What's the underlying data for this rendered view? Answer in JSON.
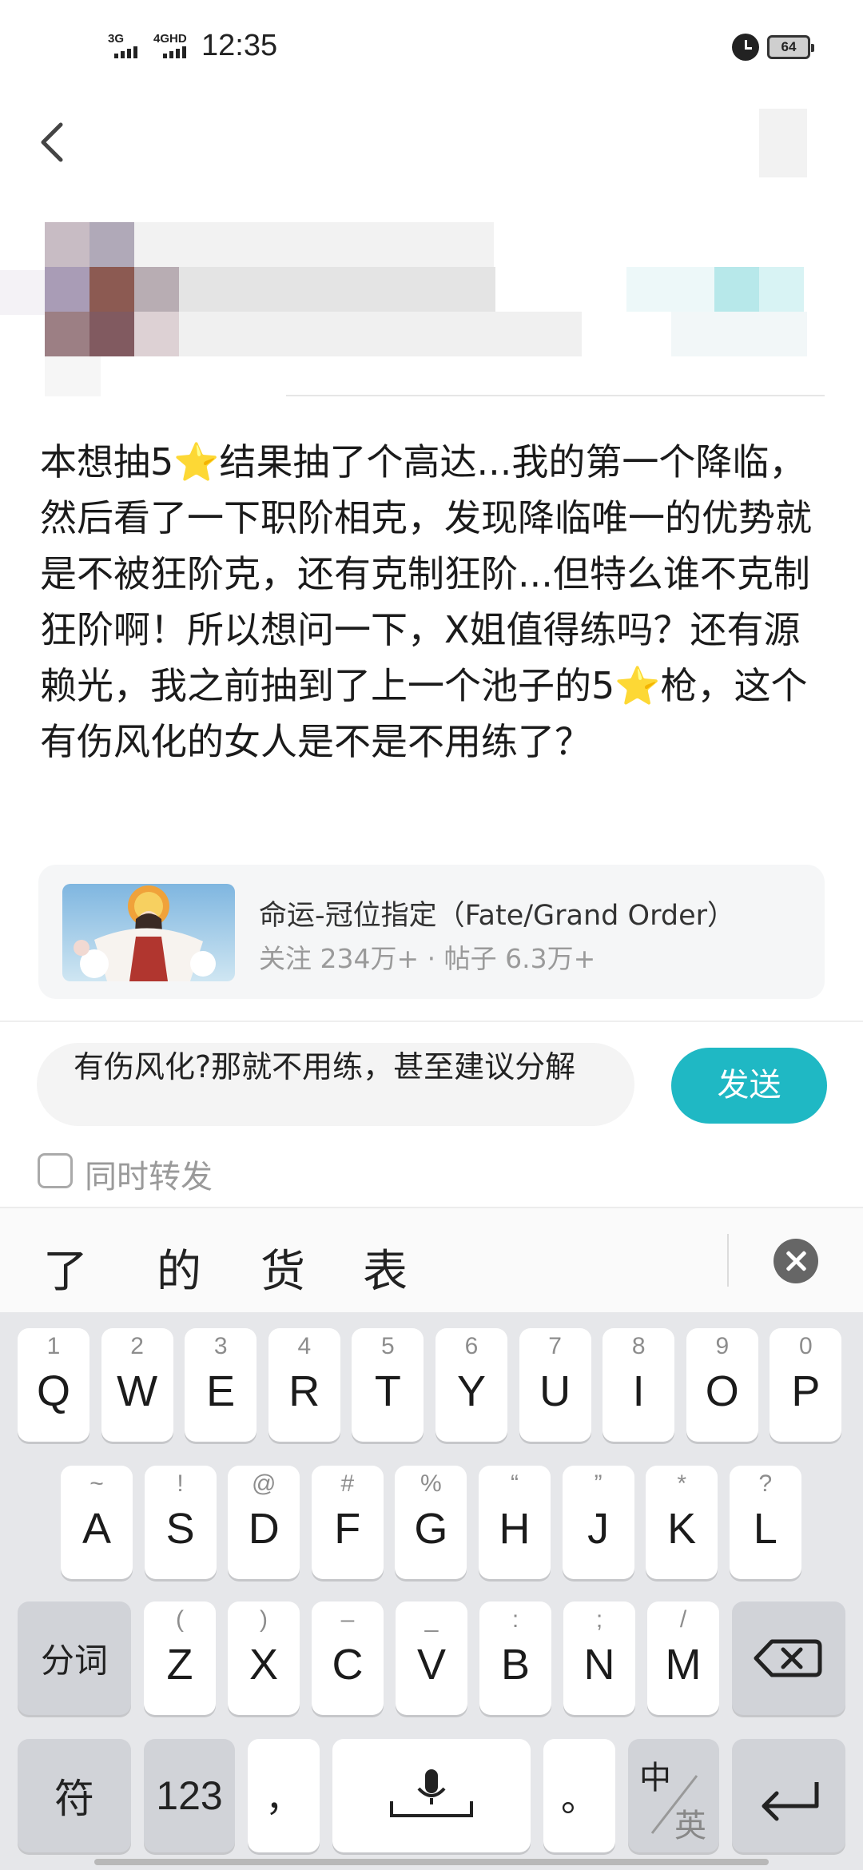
{
  "status_bar": {
    "signal1_label": "3G",
    "signal2_label": "4GHD",
    "time": "12:35",
    "battery": "64"
  },
  "header": {
    "back_icon": "chevron-left-icon"
  },
  "post": {
    "body_text": "本想抽5⭐结果抽了个高达...我的第一个降临，然后看了一下职阶相克，发现降临唯一的优势就是不被狂阶克，还有克制狂阶...但特么谁不克制狂阶啊！所以想问一下，X姐值得练吗？还有源赖光，我之前抽到了上一个池子的5⭐枪，这个有伤风化的女人是不是不用练了？"
  },
  "forum_card": {
    "title": "命运-冠位指定（Fate/Grand Order）",
    "meta": "关注 234万+ · 帖子 6.3万+"
  },
  "reply": {
    "input_value": "有伤风化?那就不用练，甚至建议分解",
    "send_label": "发送",
    "repost_label": "同时转发"
  },
  "candidates": [
    "了",
    "的",
    "货",
    "表"
  ],
  "keyboard": {
    "row1": [
      {
        "hint": "1",
        "key": "Q"
      },
      {
        "hint": "2",
        "key": "W"
      },
      {
        "hint": "3",
        "key": "E"
      },
      {
        "hint": "4",
        "key": "R"
      },
      {
        "hint": "5",
        "key": "T"
      },
      {
        "hint": "6",
        "key": "Y"
      },
      {
        "hint": "7",
        "key": "U"
      },
      {
        "hint": "8",
        "key": "I"
      },
      {
        "hint": "9",
        "key": "O"
      },
      {
        "hint": "0",
        "key": "P"
      }
    ],
    "row2": [
      {
        "hint": "~",
        "key": "A"
      },
      {
        "hint": "!",
        "key": "S"
      },
      {
        "hint": "@",
        "key": "D"
      },
      {
        "hint": "#",
        "key": "F"
      },
      {
        "hint": "%",
        "key": "G"
      },
      {
        "hint": "“",
        "key": "H"
      },
      {
        "hint": "”",
        "key": "J"
      },
      {
        "hint": "*",
        "key": "K"
      },
      {
        "hint": "?",
        "key": "L"
      }
    ],
    "row3": [
      {
        "hint": "(",
        "key": "Z"
      },
      {
        "hint": ")",
        "key": "X"
      },
      {
        "hint": "–",
        "key": "C"
      },
      {
        "hint": "_",
        "key": "V"
      },
      {
        "hint": ":",
        "key": "B"
      },
      {
        "hint": ";",
        "key": "N"
      },
      {
        "hint": "/",
        "key": "M"
      }
    ],
    "segment_label": "分词",
    "symbol_label": "符",
    "num_label": "123",
    "comma_label": "，",
    "period_label": "。",
    "lang_zh": "中",
    "lang_en": "英"
  }
}
